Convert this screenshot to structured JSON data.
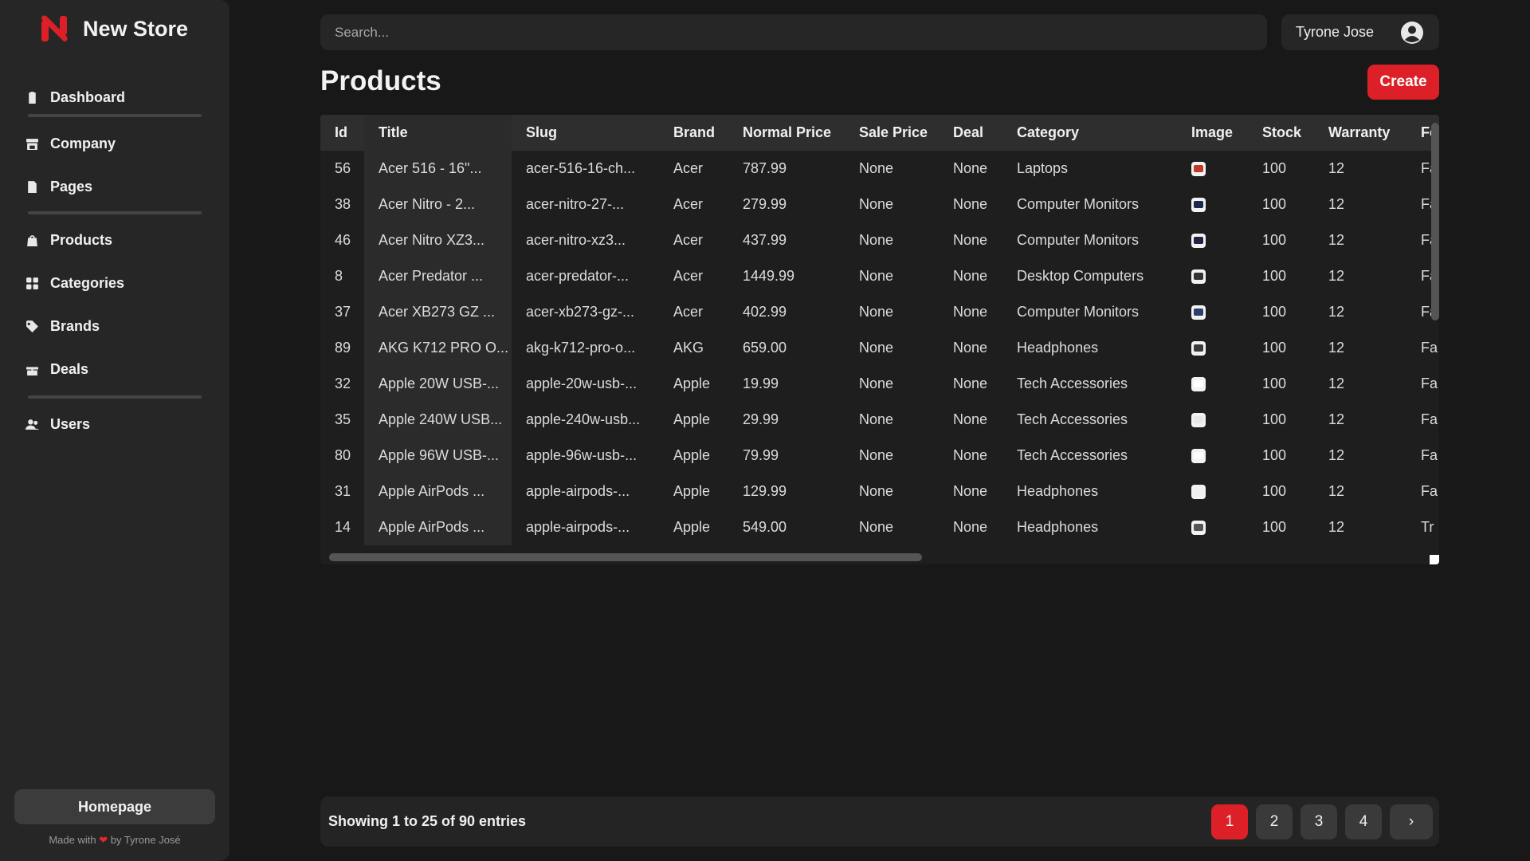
{
  "app": {
    "name": "New Store"
  },
  "sidebar": {
    "groups": [
      [
        {
          "label": "Dashboard",
          "icon": "clipboard-icon"
        }
      ],
      [
        {
          "label": "Company",
          "icon": "store-icon"
        },
        {
          "label": "Pages",
          "icon": "file-icon"
        }
      ],
      [
        {
          "label": "Products",
          "icon": "bag-icon"
        },
        {
          "label": "Categories",
          "icon": "grid-icon"
        },
        {
          "label": "Brands",
          "icon": "tag-icon"
        },
        {
          "label": "Deals",
          "icon": "gift-icon"
        }
      ],
      [
        {
          "label": "Users",
          "icon": "users-icon"
        }
      ]
    ],
    "homepage_label": "Homepage",
    "made_with": "Made with",
    "by": "by",
    "author": "Tyrone José"
  },
  "header": {
    "search_placeholder": "Search...",
    "user_name": "Tyrone Jose"
  },
  "page": {
    "title": "Products",
    "create_label": "Create"
  },
  "table": {
    "columns": [
      "Id",
      "Title",
      "Slug",
      "Brand",
      "Normal Price",
      "Sale Price",
      "Deal",
      "Category",
      "Image",
      "Stock",
      "Warranty",
      "Fe"
    ],
    "rows": [
      [
        "56",
        "Acer 516 - 16\"...",
        "acer-516-16-ch...",
        "Acer",
        "787.99",
        "None",
        "None",
        "Laptops",
        "",
        "100",
        "12",
        "Fa"
      ],
      [
        "38",
        "Acer Nitro - 2...",
        "acer-nitro-27-...",
        "Acer",
        "279.99",
        "None",
        "None",
        "Computer Monitors",
        "",
        "100",
        "12",
        "Fa"
      ],
      [
        "46",
        "Acer Nitro XZ3...",
        "acer-nitro-xz3...",
        "Acer",
        "437.99",
        "None",
        "None",
        "Computer Monitors",
        "",
        "100",
        "12",
        "Fa"
      ],
      [
        "8",
        "Acer Predator ...",
        "acer-predator-...",
        "Acer",
        "1449.99",
        "None",
        "None",
        "Desktop Computers",
        "",
        "100",
        "12",
        "Fa"
      ],
      [
        "37",
        "Acer XB273 GZ ...",
        "acer-xb273-gz-...",
        "Acer",
        "402.99",
        "None",
        "None",
        "Computer Monitors",
        "",
        "100",
        "12",
        "Fa"
      ],
      [
        "89",
        "AKG K712 PRO O...",
        "akg-k712-pro-o...",
        "AKG",
        "659.00",
        "None",
        "None",
        "Headphones",
        "",
        "100",
        "12",
        "Fa"
      ],
      [
        "32",
        "Apple 20W USB-...",
        "apple-20w-usb-...",
        "Apple",
        "19.99",
        "None",
        "None",
        "Tech Accessories",
        "",
        "100",
        "12",
        "Fa"
      ],
      [
        "35",
        "Apple 240W USB...",
        "apple-240w-usb...",
        "Apple",
        "29.99",
        "None",
        "None",
        "Tech Accessories",
        "",
        "100",
        "12",
        "Fa"
      ],
      [
        "80",
        "Apple 96W USB-...",
        "apple-96w-usb-...",
        "Apple",
        "79.99",
        "None",
        "None",
        "Tech Accessories",
        "",
        "100",
        "12",
        "Fa"
      ],
      [
        "31",
        "Apple AirPods ...",
        "apple-airpods-...",
        "Apple",
        "129.99",
        "None",
        "None",
        "Headphones",
        "",
        "100",
        "12",
        "Fa"
      ],
      [
        "14",
        "Apple AirPods ...",
        "apple-airpods-...",
        "Apple",
        "549.00",
        "None",
        "None",
        "Headphones",
        "",
        "100",
        "12",
        "Tr"
      ]
    ],
    "image_colors": [
      "#c0392b",
      "#1b2a4a",
      "#222244",
      "#333333",
      "#2a3f6a",
      "#3a3a3a",
      "#ffffff",
      "#e8e8e8",
      "#ffffff",
      "#f0f0f0",
      "#555555"
    ]
  },
  "footer": {
    "entries_text": "Showing 1 to 25 of 90 entries",
    "pages": [
      "1",
      "2",
      "3",
      "4"
    ],
    "active_page": "1",
    "next_glyph": "›"
  },
  "colors": {
    "accent": "#dd2027",
    "background": "#181818",
    "panel": "#262626"
  }
}
